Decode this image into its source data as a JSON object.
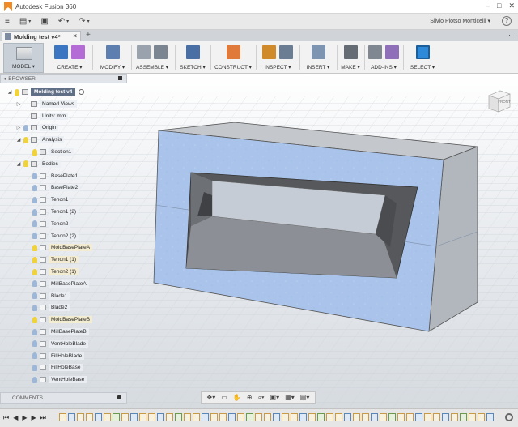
{
  "app": {
    "title": "Autodesk Fusion 360",
    "user": "Silvio Plotso Monticelli",
    "user_caret": "▾",
    "help": "?"
  },
  "window_controls": [
    "–",
    "□",
    "✕"
  ],
  "qat": {
    "menu_icon": "≡",
    "file_icon": "▤",
    "save_icon": "▣",
    "undo_icon": "↶",
    "redo_icon": "↷",
    "caret": "▾"
  },
  "document_tab": {
    "label": "Molding test v4*",
    "close": "×",
    "new_tab": "+"
  },
  "ribbon": {
    "workspace": "MODEL ▾",
    "groups": [
      {
        "label": "CREATE ▾",
        "colors": [
          "#3a76c2",
          "#b46bd6"
        ]
      },
      {
        "label": "MODIFY ▾",
        "colors": [
          "#5c7fb0"
        ]
      },
      {
        "label": "ASSEMBLE ▾",
        "colors": [
          "#9aa3ad",
          "#7a8591"
        ]
      },
      {
        "label": "SKETCH ▾",
        "colors": [
          "#4a6fa5"
        ]
      },
      {
        "label": "CONSTRUCT ▾",
        "colors": [
          "#e07a3a"
        ]
      },
      {
        "label": "INSPECT ▾",
        "colors": [
          "#d08a2a",
          "#6b7d92"
        ]
      },
      {
        "label": "INSERT ▾",
        "colors": [
          "#7d95b0"
        ]
      },
      {
        "label": "MAKE ▾",
        "colors": [
          "#666c74"
        ]
      },
      {
        "label": "ADD-INS ▾",
        "colors": [
          "#7f8791",
          "#8f6fb8"
        ]
      },
      {
        "label": "SELECT ▾",
        "colors": [
          "#2e8ad8"
        ]
      }
    ],
    "viewcube_label": "FRONT"
  },
  "browser": {
    "header": "BROWSER",
    "items": [
      {
        "label": "Molding test v4",
        "indent": 0,
        "twisty": "◢",
        "bulb": "on",
        "icon": "root"
      },
      {
        "label": "Named Views",
        "indent": 1,
        "twisty": "▷",
        "bulb": "",
        "icon": "folder"
      },
      {
        "label": "Units: mm",
        "indent": 1,
        "twisty": "",
        "bulb": "",
        "icon": "doc"
      },
      {
        "label": "Origin",
        "indent": 1,
        "twisty": "▷",
        "bulb": "off",
        "icon": "folder"
      },
      {
        "label": "Analysis",
        "indent": 1,
        "twisty": "◢",
        "bulb": "on",
        "icon": "folder"
      },
      {
        "label": "Section1",
        "indent": 2,
        "twisty": "",
        "bulb": "on",
        "icon": "section"
      },
      {
        "label": "Bodies",
        "indent": 1,
        "twisty": "◢",
        "bulb": "on",
        "icon": "folder"
      },
      {
        "label": "BasePlate1",
        "indent": 2,
        "twisty": "",
        "bulb": "off",
        "icon": "body"
      },
      {
        "label": "BasePlate2",
        "indent": 2,
        "twisty": "",
        "bulb": "off",
        "icon": "body"
      },
      {
        "label": "Tenon1",
        "indent": 2,
        "twisty": "",
        "bulb": "off",
        "icon": "body"
      },
      {
        "label": "Tenon1 (2)",
        "indent": 2,
        "twisty": "",
        "bulb": "off",
        "icon": "body"
      },
      {
        "label": "Tenon2",
        "indent": 2,
        "twisty": "",
        "bulb": "off",
        "icon": "body"
      },
      {
        "label": "Tenon2 (2)",
        "indent": 2,
        "twisty": "",
        "bulb": "off",
        "icon": "body"
      },
      {
        "label": "MoldBasePlateA",
        "indent": 2,
        "twisty": "",
        "bulb": "on",
        "icon": "body",
        "alt": true
      },
      {
        "label": "Tenon1 (1)",
        "indent": 2,
        "twisty": "",
        "bulb": "on",
        "icon": "body",
        "alt": true
      },
      {
        "label": "Tenon2 (1)",
        "indent": 2,
        "twisty": "",
        "bulb": "on",
        "icon": "body",
        "alt": true
      },
      {
        "label": "MillBasePlateA",
        "indent": 2,
        "twisty": "",
        "bulb": "off",
        "icon": "body"
      },
      {
        "label": "Blade1",
        "indent": 2,
        "twisty": "",
        "bulb": "off",
        "icon": "body"
      },
      {
        "label": "Blade2",
        "indent": 2,
        "twisty": "",
        "bulb": "off",
        "icon": "body"
      },
      {
        "label": "MoldBasePlateB",
        "indent": 2,
        "twisty": "",
        "bulb": "on",
        "icon": "body",
        "alt": true
      },
      {
        "label": "MillBasePlateB",
        "indent": 2,
        "twisty": "",
        "bulb": "off",
        "icon": "body"
      },
      {
        "label": "VentHoleBlade",
        "indent": 2,
        "twisty": "",
        "bulb": "off",
        "icon": "body"
      },
      {
        "label": "FillHoleBlade",
        "indent": 2,
        "twisty": "",
        "bulb": "off",
        "icon": "body"
      },
      {
        "label": "FillHoleBase",
        "indent": 2,
        "twisty": "",
        "bulb": "off",
        "icon": "body"
      },
      {
        "label": "VentHoleBase",
        "indent": 2,
        "twisty": "",
        "bulb": "off",
        "icon": "body"
      }
    ]
  },
  "comments": {
    "label": "COMMENTS"
  },
  "navbar": {
    "icons": [
      "✥▾",
      "▭",
      "✋",
      "⊕",
      "⌕▾",
      "▣▾",
      "▦▾",
      "▤▾"
    ]
  },
  "timeline": {
    "controls": [
      "⏮",
      "◀",
      "▶",
      "▶",
      "⏭"
    ],
    "item_kinds": [
      "s",
      "b",
      "s",
      "s",
      "b",
      "s",
      "g",
      "s",
      "b",
      "s",
      "s",
      "b",
      "s",
      "g",
      "s",
      "s",
      "b",
      "s",
      "s",
      "b",
      "s",
      "g",
      "s",
      "s",
      "b",
      "s",
      "s",
      "b",
      "s",
      "g",
      "s",
      "s",
      "b",
      "s",
      "s",
      "b",
      "s",
      "g",
      "s",
      "s",
      "b",
      "s",
      "s",
      "b",
      "s",
      "g",
      "s",
      "s",
      "b"
    ]
  },
  "colors": {
    "model_face_blue": "#a9c3ea",
    "model_face_gray": "#b4b9bf",
    "select_accent": "#2e8ad8",
    "tab_root": "#5f6f86"
  }
}
